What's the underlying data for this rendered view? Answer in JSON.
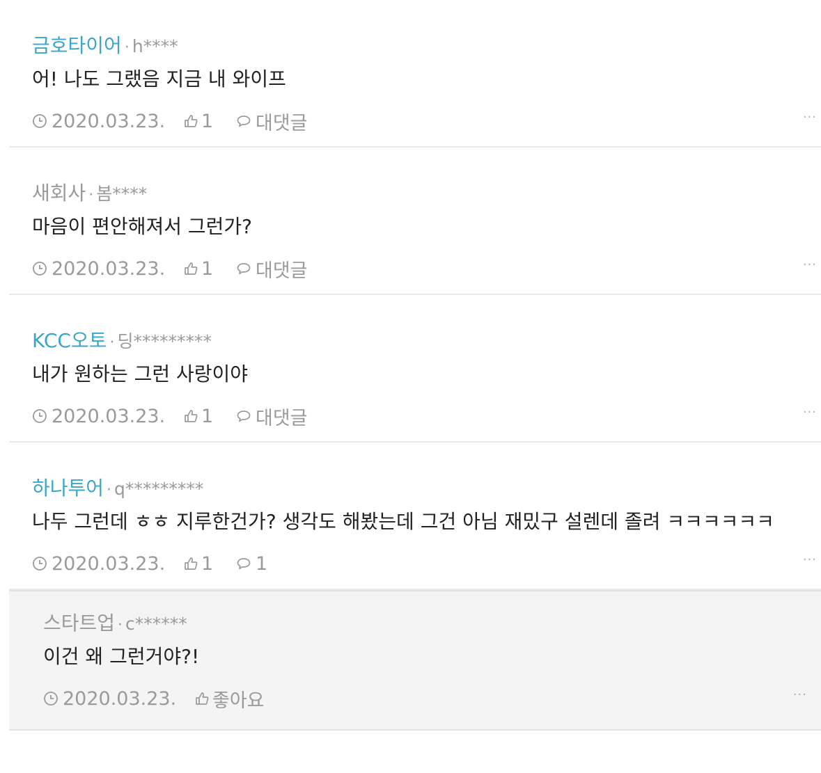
{
  "comments": [
    {
      "company": "금호타이어",
      "separator": "·",
      "user": "h****",
      "text": "어! 나도 그랬음 지금 내 와이프",
      "date": "2020.03.23.",
      "likes": "1",
      "reply_label": "대댓글",
      "more": "···"
    },
    {
      "company": "새회사",
      "separator": "·",
      "user": "봄****",
      "text": "마음이 편안해져서 그런가?",
      "date": "2020.03.23.",
      "likes": "1",
      "reply_label": "대댓글",
      "more": "···"
    },
    {
      "company": "KCC오토",
      "separator": "·",
      "user": "딩*********",
      "text": "내가 원하는 그런 사랑이야",
      "date": "2020.03.23.",
      "likes": "1",
      "reply_label": "대댓글",
      "more": "···"
    },
    {
      "company": "하나투어",
      "separator": "·",
      "user": "q*********",
      "text": "나두 그런데 ㅎㅎ 지루한건가? 생각도 해봤는데 그건 아님 재밌구 설렌데 졸려 ㅋㅋㅋㅋㅋㅋ",
      "date": "2020.03.23.",
      "likes": "1",
      "reply_label": "1",
      "more": "···"
    }
  ],
  "reply": {
    "company": "스타트업",
    "separator": "·",
    "user": "c******",
    "text": "이건 왜 그런거야?!",
    "date": "2020.03.23.",
    "like_label": "좋아요",
    "more": "···"
  },
  "colors": {
    "company_link": "#3aa7c9",
    "muted": "#9a9a9a",
    "text": "#222222",
    "reply_bg": "#f4f4f4"
  },
  "icons": {
    "date": "clock-icon",
    "like": "thumbs-up-icon",
    "reply": "speech-bubble-icon"
  }
}
